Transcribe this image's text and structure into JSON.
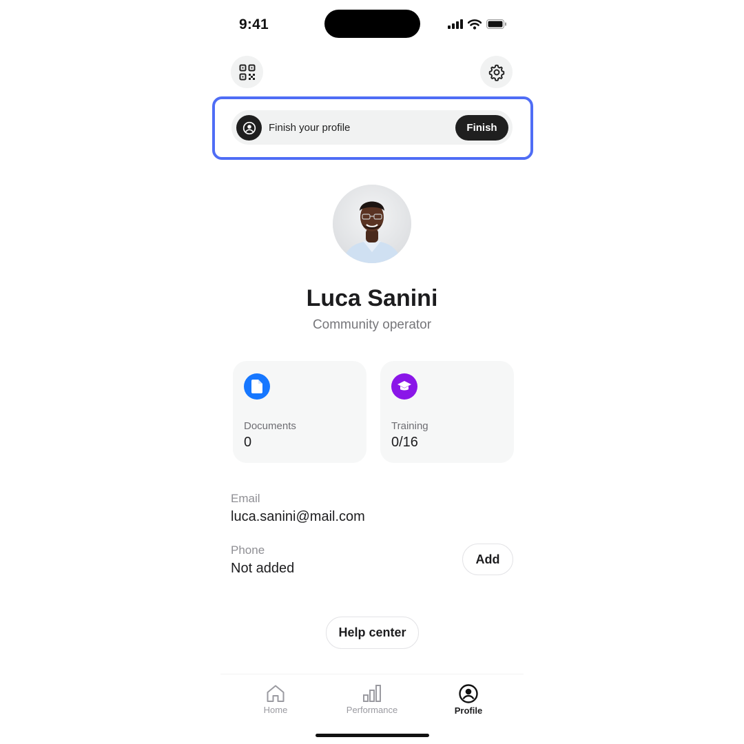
{
  "status_bar": {
    "time": "9:41"
  },
  "header": {
    "left_icon": "qr-code-icon",
    "right_icon": "gear-icon"
  },
  "banner": {
    "text": "Finish your profile",
    "button_label": "Finish",
    "icon": "user-circle-icon",
    "highlight_color": "#4f6df5"
  },
  "profile": {
    "name": "Luca Sanini",
    "role": "Community operator",
    "avatar": "avatar-photo"
  },
  "stats": [
    {
      "label": "Documents",
      "value": "0",
      "icon": "document-icon",
      "icon_color": "#1677ff"
    },
    {
      "label": "Training",
      "value": "0/16",
      "icon": "graduation-cap-icon",
      "icon_color": "#8a16e8"
    }
  ],
  "contact": {
    "email_label": "Email",
    "email_value": "luca.sanini@mail.com",
    "phone_label": "Phone",
    "phone_value": "Not added",
    "add_label": "Add"
  },
  "help_label": "Help center",
  "tabbar": {
    "items": [
      {
        "label": "Home",
        "icon": "home-icon",
        "active": false
      },
      {
        "label": "Performance",
        "icon": "bar-chart-icon",
        "active": false
      },
      {
        "label": "Profile",
        "icon": "user-circle-icon",
        "active": true
      }
    ]
  }
}
